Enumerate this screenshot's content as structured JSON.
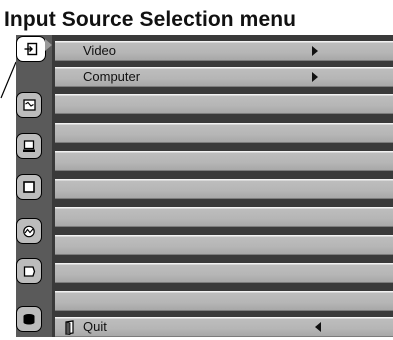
{
  "page": {
    "title": "Input Source Selection menu"
  },
  "sidebar": {
    "tabs": [
      {
        "name": "input-tab",
        "icon": "input-icon",
        "active": true
      },
      {
        "name": "image-adjust-tab",
        "icon": "image-adjust-icon",
        "active": false
      },
      {
        "name": "computer-tab",
        "icon": "computer-icon",
        "active": false
      },
      {
        "name": "screen-tab",
        "icon": "screen-icon",
        "active": false
      },
      {
        "name": "image-select-tab",
        "icon": "image-select-icon",
        "active": false
      },
      {
        "name": "setting-tab",
        "icon": "setting-icon",
        "active": false
      },
      {
        "name": "info-tab",
        "icon": "info-icon",
        "active": false
      }
    ]
  },
  "menu": {
    "items": [
      {
        "label": "Video",
        "arrow": "right"
      },
      {
        "label": "Computer",
        "arrow": "right"
      }
    ],
    "quit": {
      "label": "Quit",
      "icon": "quit-icon",
      "arrow": "left"
    }
  },
  "colors": {
    "panel_background": "#3a3a3a",
    "row_gray": "#b6b6b6",
    "tab_gray": "#bcbcbc",
    "active_tab": "#ffffff"
  }
}
